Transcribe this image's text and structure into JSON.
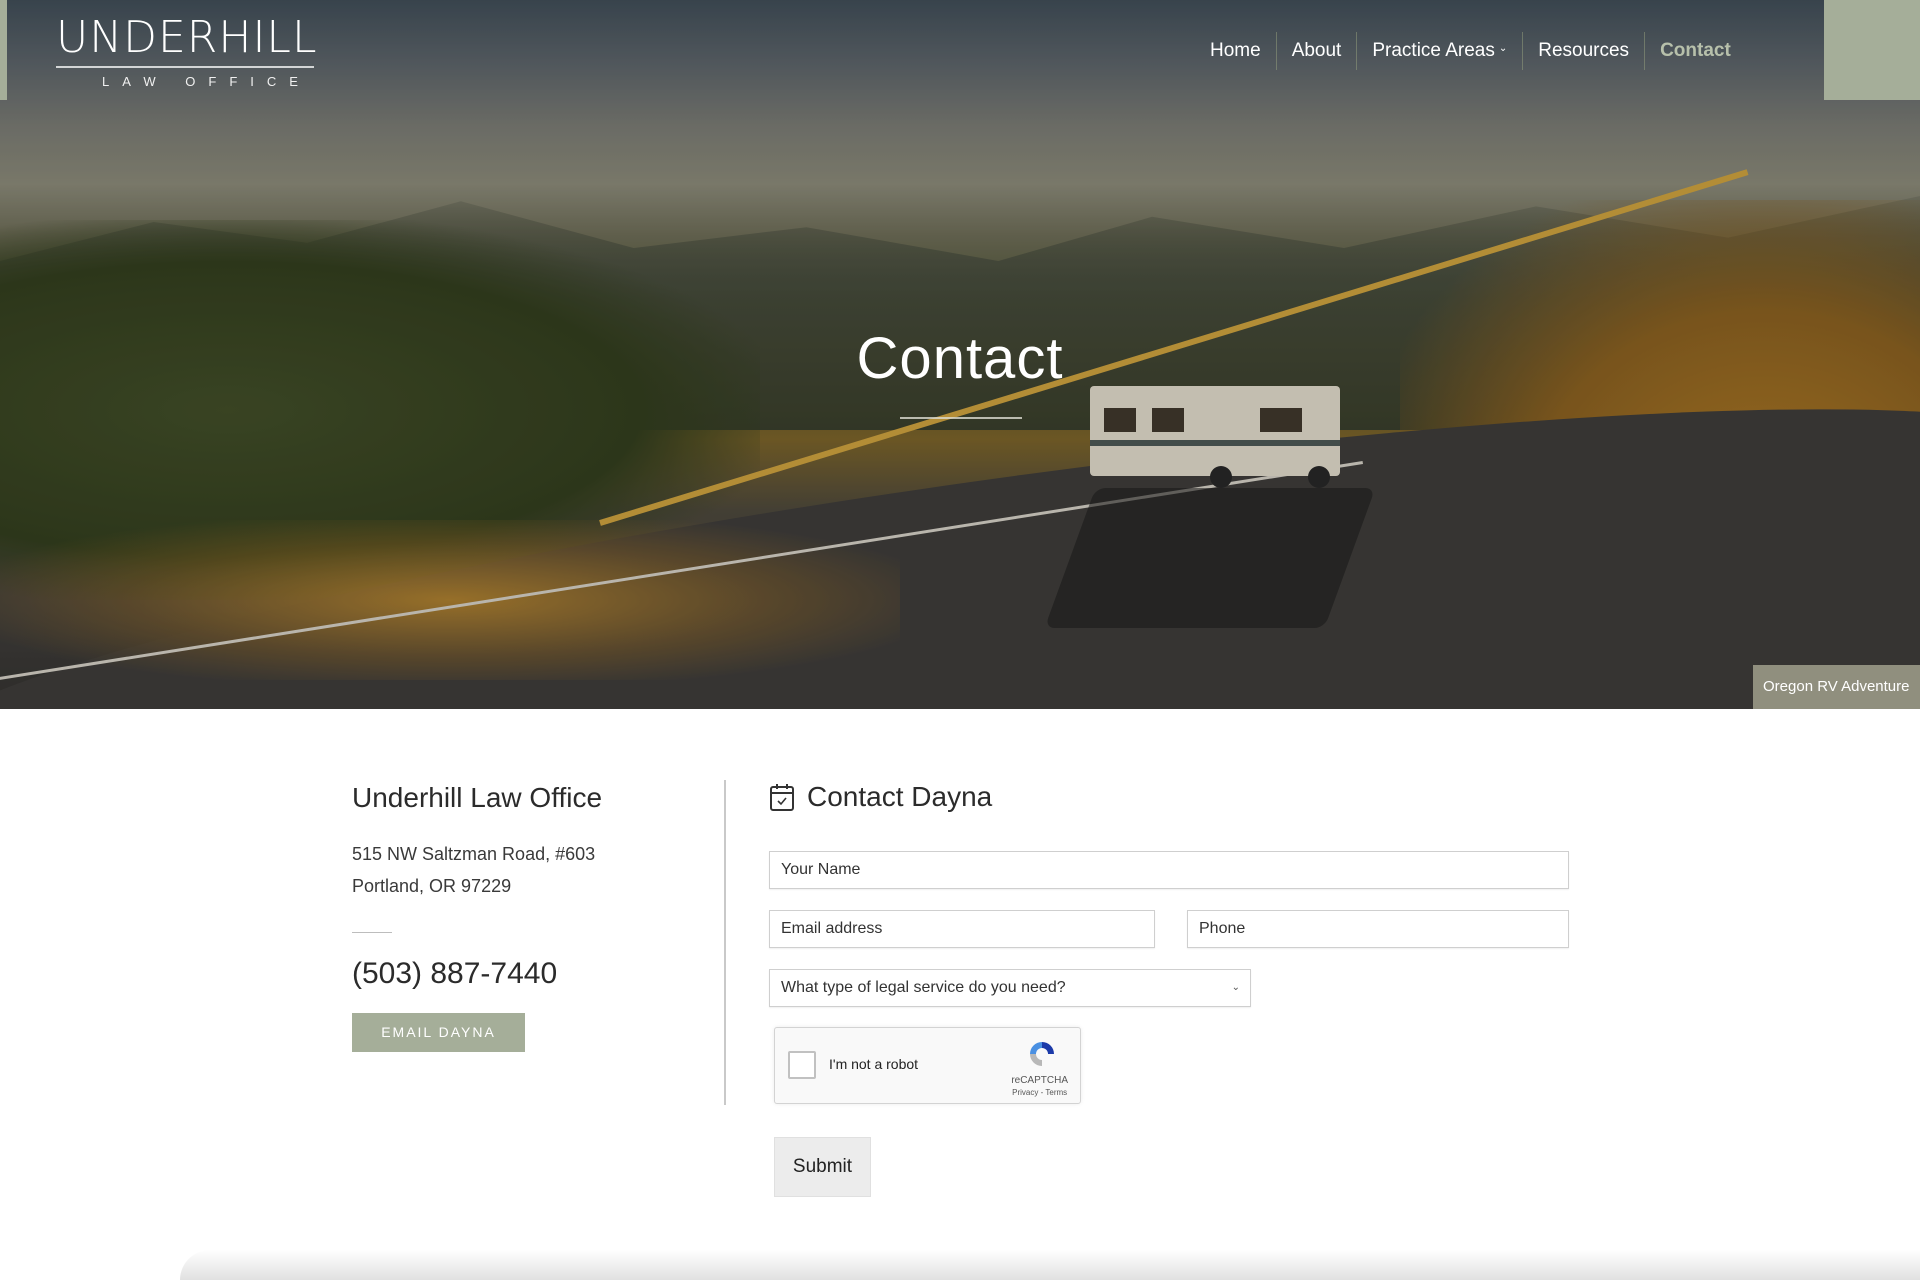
{
  "brand": {
    "name": "UNDERHILL",
    "tagline": "LAW OFFICE"
  },
  "nav": {
    "items": [
      {
        "label": "Home",
        "active": false
      },
      {
        "label": "About",
        "active": false
      },
      {
        "label": "Practice Areas",
        "active": false,
        "has_dropdown": true,
        "dropdown_icon": "chevron-down-icon"
      },
      {
        "label": "Resources",
        "active": false
      },
      {
        "label": "Contact",
        "active": true
      }
    ]
  },
  "hero": {
    "title": "Contact",
    "image_caption": "Oregon RV Adventure"
  },
  "office": {
    "title": "Underhill Law Office",
    "address_line1": "515 NW Saltzman Road, #603",
    "address_line2": "Portland, OR 97229",
    "phone": "(503) 887-7440",
    "email_button_label": "EMAIL DAYNA"
  },
  "form": {
    "title": "Contact Dayna",
    "title_icon": "calendar-check-icon",
    "fields": {
      "name_placeholder": "Your Name",
      "email_placeholder": "Email address",
      "phone_placeholder": "Phone",
      "service_select_value": "What type of legal service do you need?"
    },
    "captcha": {
      "label": "I'm not a robot",
      "brand": "reCAPTCHA",
      "privacy": "Privacy",
      "separator": "-",
      "terms": "Terms"
    },
    "submit_label": "Submit"
  },
  "colors": {
    "accent_sage": "#a5ae99",
    "text_dark": "#2b2b2b",
    "active_nav": "#b7c0ab"
  }
}
